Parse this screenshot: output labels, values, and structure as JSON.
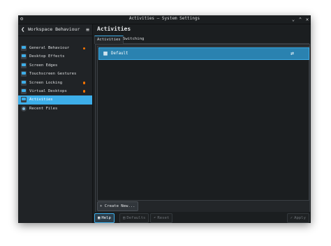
{
  "window": {
    "title": "Activities — System Settings",
    "controls": {
      "minimize": "⌄",
      "maximize": "⌃",
      "close": "✕"
    }
  },
  "sidebar": {
    "back_glyph": "❮",
    "title": "Workspace Behaviour",
    "menu_glyph": "≡",
    "items": [
      {
        "label": "General Behaviour",
        "icon": "general-behaviour-icon",
        "modified": true
      },
      {
        "label": "Desktop Effects",
        "icon": "desktop-effects-icon",
        "modified": false
      },
      {
        "label": "Screen Edges",
        "icon": "screen-edges-icon",
        "modified": false
      },
      {
        "label": "Touchscreen Gestures",
        "icon": "touchscreen-gestures-icon",
        "modified": false
      },
      {
        "label": "Screen Locking",
        "icon": "screen-locking-icon",
        "modified": true
      },
      {
        "label": "Virtual Desktops",
        "icon": "virtual-desktops-icon",
        "modified": true
      },
      {
        "label": "Activities",
        "icon": "activities-icon",
        "modified": false,
        "selected": true
      },
      {
        "label": "Recent Files",
        "icon": "recent-files-icon",
        "modified": false
      }
    ]
  },
  "main": {
    "title": "Activities",
    "tabs": [
      {
        "label": "Activities",
        "active": true
      },
      {
        "label": "Switching",
        "active": false
      }
    ],
    "activities": [
      {
        "name": "Default",
        "icon": "activities-icon",
        "action_icon": "switch-icon",
        "action_glyph": "⇄"
      }
    ],
    "create_button": "+ Create New..."
  },
  "footer": {
    "help": "Help",
    "defaults": "Defaults",
    "reset": "Reset",
    "apply": "Apply"
  },
  "colors": {
    "accent": "#3daee9",
    "selection": "#2a82b0",
    "window_bg": "#1b1e20",
    "modified_dot": "#f67400"
  }
}
